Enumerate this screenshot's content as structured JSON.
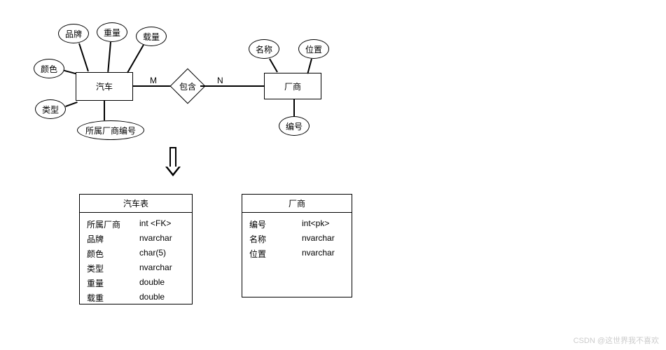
{
  "er": {
    "entities": {
      "car": {
        "label": "汽车"
      },
      "vendor": {
        "label": "厂商"
      }
    },
    "relationship": {
      "contains": {
        "label": "包含",
        "left_card": "M",
        "right_card": "N"
      }
    },
    "attributes": {
      "car": {
        "brand": "品牌",
        "weight": "重量",
        "load": "载量",
        "color": "颜色",
        "type": "类型",
        "vendor_id": "所属厂商编号"
      },
      "vendor": {
        "name": "名称",
        "location": "位置",
        "id": "编号"
      }
    }
  },
  "tables": {
    "car": {
      "title": "汽车表",
      "rows": [
        {
          "name": "所属厂商",
          "type": "int   <FK>"
        },
        {
          "name": "品牌",
          "type": "nvarchar"
        },
        {
          "name": "颜色",
          "type": "char(5)"
        },
        {
          "name": "类型",
          "type": " nvarchar"
        },
        {
          "name": "重量",
          "type": "double"
        },
        {
          "name": "载重",
          "type": "double"
        }
      ]
    },
    "vendor": {
      "title": "厂商",
      "rows": [
        {
          "name": "编号",
          "type": "int<pk>"
        },
        {
          "name": "名称",
          "type": "nvarchar"
        },
        {
          "name": "位置",
          "type": "nvarchar"
        }
      ]
    }
  },
  "watermark": "CSDN @这世界我不喜欢"
}
